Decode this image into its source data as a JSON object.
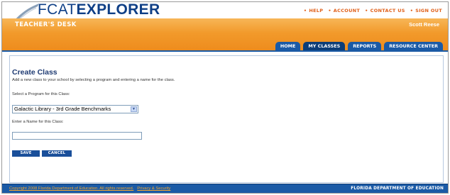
{
  "header": {
    "logo_light": "FCAT",
    "logo_bold": "EXPLORER",
    "top_links": [
      "HELP",
      "ACCOUNT",
      "CONTACT US",
      "SIGN OUT"
    ],
    "desk_title": "TEACHER'S DESK",
    "user_name": "Scott Reese",
    "nav_tabs": [
      "HOME",
      "MY CLASSES",
      "REPORTS",
      "RESOURCE CENTER"
    ],
    "active_tab": "MY CLASSES"
  },
  "form": {
    "title": "Create Class",
    "description": "Add a new class to your school by selecting a program and entering a name for the class.",
    "program_label": "Select a Program for this Class:",
    "program_value": "Galactic Library - 3rd Grade Benchmarks",
    "name_label": "Enter a Name for this Class:",
    "name_value": "",
    "save_label": "SAVE",
    "cancel_label": "CANCEL"
  },
  "footer": {
    "copyright": "Copyright 2008 Florida Department of Education. All rights reserved.",
    "privacy_link": "Privacy & Security",
    "department": "FLORIDA DEPARTMENT OF EDUCATION"
  },
  "colors": {
    "brand_blue": "#1a5aa6",
    "brand_orange": "#f29a2b",
    "title_blue": "#1f3b73"
  }
}
